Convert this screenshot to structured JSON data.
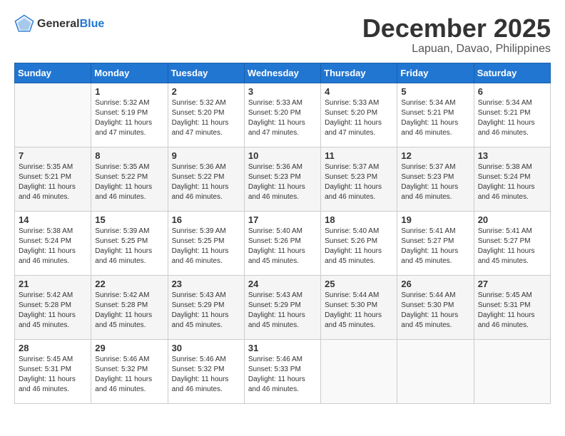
{
  "header": {
    "logo_general": "General",
    "logo_blue": "Blue",
    "month_year": "December 2025",
    "location": "Lapuan, Davao, Philippines"
  },
  "weekdays": [
    "Sunday",
    "Monday",
    "Tuesday",
    "Wednesday",
    "Thursday",
    "Friday",
    "Saturday"
  ],
  "weeks": [
    [
      {
        "day": "",
        "empty": true
      },
      {
        "day": "1",
        "sunrise": "5:32 AM",
        "sunset": "5:19 PM",
        "daylight": "11 hours and 47 minutes."
      },
      {
        "day": "2",
        "sunrise": "5:32 AM",
        "sunset": "5:20 PM",
        "daylight": "11 hours and 47 minutes."
      },
      {
        "day": "3",
        "sunrise": "5:33 AM",
        "sunset": "5:20 PM",
        "daylight": "11 hours and 47 minutes."
      },
      {
        "day": "4",
        "sunrise": "5:33 AM",
        "sunset": "5:20 PM",
        "daylight": "11 hours and 47 minutes."
      },
      {
        "day": "5",
        "sunrise": "5:34 AM",
        "sunset": "5:21 PM",
        "daylight": "11 hours and 46 minutes."
      },
      {
        "day": "6",
        "sunrise": "5:34 AM",
        "sunset": "5:21 PM",
        "daylight": "11 hours and 46 minutes."
      }
    ],
    [
      {
        "day": "7",
        "sunrise": "5:35 AM",
        "sunset": "5:21 PM",
        "daylight": "11 hours and 46 minutes."
      },
      {
        "day": "8",
        "sunrise": "5:35 AM",
        "sunset": "5:22 PM",
        "daylight": "11 hours and 46 minutes."
      },
      {
        "day": "9",
        "sunrise": "5:36 AM",
        "sunset": "5:22 PM",
        "daylight": "11 hours and 46 minutes."
      },
      {
        "day": "10",
        "sunrise": "5:36 AM",
        "sunset": "5:23 PM",
        "daylight": "11 hours and 46 minutes."
      },
      {
        "day": "11",
        "sunrise": "5:37 AM",
        "sunset": "5:23 PM",
        "daylight": "11 hours and 46 minutes."
      },
      {
        "day": "12",
        "sunrise": "5:37 AM",
        "sunset": "5:23 PM",
        "daylight": "11 hours and 46 minutes."
      },
      {
        "day": "13",
        "sunrise": "5:38 AM",
        "sunset": "5:24 PM",
        "daylight": "11 hours and 46 minutes."
      }
    ],
    [
      {
        "day": "14",
        "sunrise": "5:38 AM",
        "sunset": "5:24 PM",
        "daylight": "11 hours and 46 minutes."
      },
      {
        "day": "15",
        "sunrise": "5:39 AM",
        "sunset": "5:25 PM",
        "daylight": "11 hours and 46 minutes."
      },
      {
        "day": "16",
        "sunrise": "5:39 AM",
        "sunset": "5:25 PM",
        "daylight": "11 hours and 46 minutes."
      },
      {
        "day": "17",
        "sunrise": "5:40 AM",
        "sunset": "5:26 PM",
        "daylight": "11 hours and 45 minutes."
      },
      {
        "day": "18",
        "sunrise": "5:40 AM",
        "sunset": "5:26 PM",
        "daylight": "11 hours and 45 minutes."
      },
      {
        "day": "19",
        "sunrise": "5:41 AM",
        "sunset": "5:27 PM",
        "daylight": "11 hours and 45 minutes."
      },
      {
        "day": "20",
        "sunrise": "5:41 AM",
        "sunset": "5:27 PM",
        "daylight": "11 hours and 45 minutes."
      }
    ],
    [
      {
        "day": "21",
        "sunrise": "5:42 AM",
        "sunset": "5:28 PM",
        "daylight": "11 hours and 45 minutes."
      },
      {
        "day": "22",
        "sunrise": "5:42 AM",
        "sunset": "5:28 PM",
        "daylight": "11 hours and 45 minutes."
      },
      {
        "day": "23",
        "sunrise": "5:43 AM",
        "sunset": "5:29 PM",
        "daylight": "11 hours and 45 minutes."
      },
      {
        "day": "24",
        "sunrise": "5:43 AM",
        "sunset": "5:29 PM",
        "daylight": "11 hours and 45 minutes."
      },
      {
        "day": "25",
        "sunrise": "5:44 AM",
        "sunset": "5:30 PM",
        "daylight": "11 hours and 45 minutes."
      },
      {
        "day": "26",
        "sunrise": "5:44 AM",
        "sunset": "5:30 PM",
        "daylight": "11 hours and 45 minutes."
      },
      {
        "day": "27",
        "sunrise": "5:45 AM",
        "sunset": "5:31 PM",
        "daylight": "11 hours and 46 minutes."
      }
    ],
    [
      {
        "day": "28",
        "sunrise": "5:45 AM",
        "sunset": "5:31 PM",
        "daylight": "11 hours and 46 minutes."
      },
      {
        "day": "29",
        "sunrise": "5:46 AM",
        "sunset": "5:32 PM",
        "daylight": "11 hours and 46 minutes."
      },
      {
        "day": "30",
        "sunrise": "5:46 AM",
        "sunset": "5:32 PM",
        "daylight": "11 hours and 46 minutes."
      },
      {
        "day": "31",
        "sunrise": "5:46 AM",
        "sunset": "5:33 PM",
        "daylight": "11 hours and 46 minutes."
      },
      {
        "day": "",
        "empty": true
      },
      {
        "day": "",
        "empty": true
      },
      {
        "day": "",
        "empty": true
      }
    ]
  ],
  "labels": {
    "sunrise_prefix": "Sunrise: ",
    "sunset_prefix": "Sunset: ",
    "daylight_prefix": "Daylight: "
  }
}
